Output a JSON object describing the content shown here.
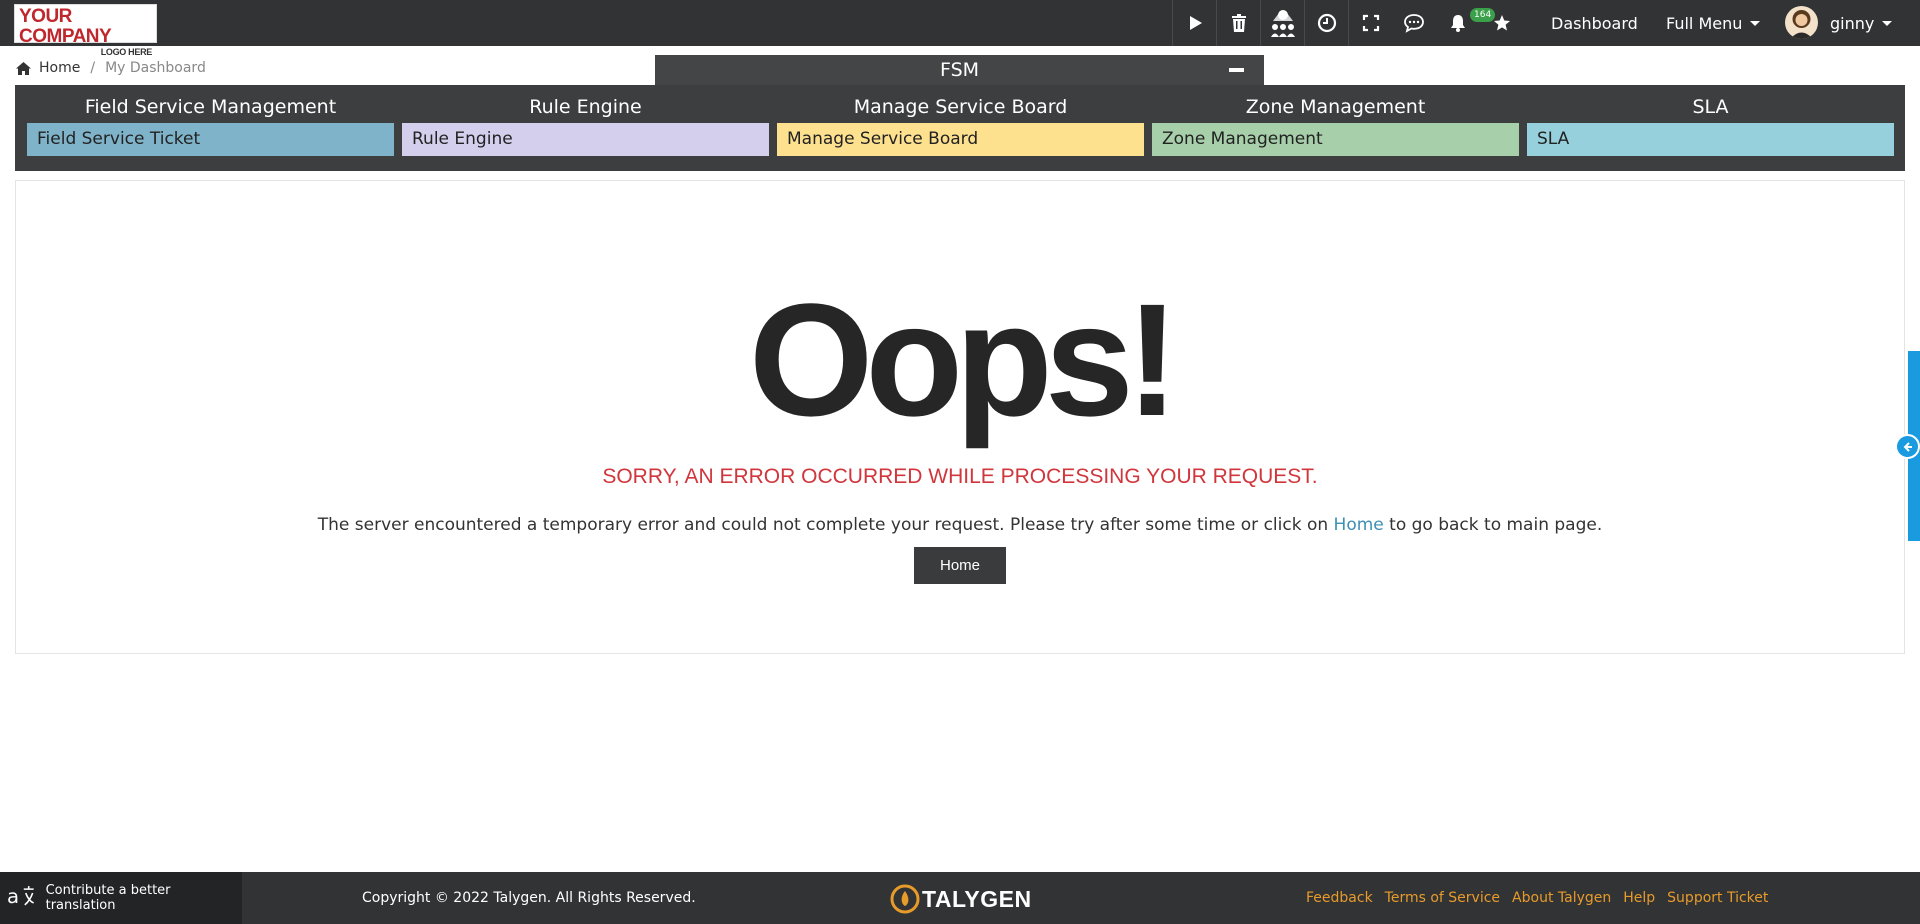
{
  "logo": {
    "line1": "YOUR COMPANY",
    "line2": "LOGO HERE"
  },
  "topbar": {
    "icons": [
      "play-icon",
      "trash-icon",
      "people-icon",
      "clock-icon",
      "fullscreen-icon",
      "chat-icon",
      "bell-icon",
      "star-icon"
    ],
    "notification_count": "164",
    "dashboard_label": "Dashboard",
    "menu_label": "Full Menu",
    "user_name": "ginny"
  },
  "breadcrumb": {
    "home": "Home",
    "current": "My Dashboard"
  },
  "fsm": {
    "title": "FSM",
    "columns": [
      {
        "title": "Field Service Management",
        "card": "Field Service Ticket",
        "color": "#7fb3c9"
      },
      {
        "title": "Rule Engine",
        "card": "Rule Engine",
        "color": "#d5cfee"
      },
      {
        "title": "Manage Service Board",
        "card": "Manage Service Board",
        "color": "#fde18f"
      },
      {
        "title": "Zone Management",
        "card": "Zone Management",
        "color": "#a6cfaa"
      },
      {
        "title": "SLA",
        "card": "SLA",
        "color": "#96d0dc"
      }
    ]
  },
  "error": {
    "heading": "Oops!",
    "title": "SORRY, AN ERROR OCCURRED WHILE PROCESSING YOUR REQUEST.",
    "message_before": "The server encountered a temporary error and could not complete your request. Please try after some time or click on ",
    "message_link": "Home",
    "message_after": " to go back to main page.",
    "button": "Home"
  },
  "footer": {
    "translate": "Contribute a better translation",
    "copyright": "Copyright © 2022 Talygen. All Rights Reserved.",
    "brand": "TALYGEN",
    "links": [
      "Feedback",
      "Terms of Service",
      "About Talygen",
      "Help",
      "Support Ticket"
    ]
  }
}
